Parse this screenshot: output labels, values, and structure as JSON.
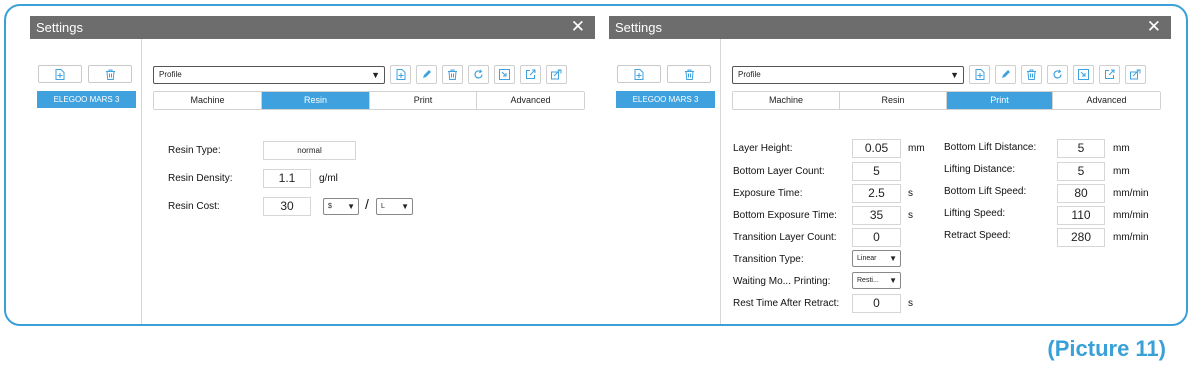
{
  "left_window": {
    "title": "Settings",
    "device": "ELEGOO MARS 3",
    "profile": "Profile",
    "tabs": [
      {
        "label": "Machine",
        "active": false
      },
      {
        "label": "Resin",
        "active": true
      },
      {
        "label": "Print",
        "active": false
      },
      {
        "label": "Advanced",
        "active": false
      }
    ],
    "fields": {
      "resin_type_label": "Resin Type:",
      "resin_type_value": "normal",
      "resin_density_label": "Resin Density:",
      "resin_density_value": "1.1",
      "resin_density_unit": "g/ml",
      "resin_cost_label": "Resin Cost:",
      "resin_cost_value": "30",
      "currency": "$",
      "separator": "/",
      "volume_unit": "L"
    }
  },
  "right_window": {
    "title": "Settings",
    "device": "ELEGOO MARS 3",
    "profile": "Profile",
    "tabs": [
      {
        "label": "Machine",
        "active": false
      },
      {
        "label": "Resin",
        "active": false
      },
      {
        "label": "Print",
        "active": true
      },
      {
        "label": "Advanced",
        "active": false
      }
    ],
    "fields_left": [
      {
        "label": "Layer Height:",
        "value": "0.05",
        "unit": "mm"
      },
      {
        "label": "Bottom Layer Count:",
        "value": "5",
        "unit": ""
      },
      {
        "label": "Exposure Time:",
        "value": "2.5",
        "unit": "s"
      },
      {
        "label": "Bottom Exposure Time:",
        "value": "35",
        "unit": "s"
      },
      {
        "label": "Transition Layer Count:",
        "value": "0",
        "unit": ""
      },
      {
        "label": "Transition Type:",
        "dropdown": "Linear"
      },
      {
        "label": "Waiting Mo... Printing:",
        "dropdown": "Resti..."
      },
      {
        "label": "Rest Time After Retract:",
        "value": "0",
        "unit": "s"
      }
    ],
    "fields_right": [
      {
        "label": "Bottom Lift Distance:",
        "value": "5",
        "unit": "mm"
      },
      {
        "label": "Lifting Distance:",
        "value": "5",
        "unit": "mm"
      },
      {
        "label": "Bottom Lift Speed:",
        "value": "80",
        "unit": "mm/min"
      },
      {
        "label": "Lifting Speed:",
        "value": "110",
        "unit": "mm/min"
      },
      {
        "label": "Retract Speed:",
        "value": "280",
        "unit": "mm/min"
      }
    ]
  },
  "icons": {
    "sidebar": [
      "add-file-icon",
      "trash-icon"
    ],
    "toolbar": [
      "add-file-icon",
      "pencil-icon",
      "trash-icon",
      "refresh-icon",
      "import-icon",
      "export-icon",
      "share-icon"
    ]
  },
  "colors": {
    "accent": "#3fa2df",
    "titlebar": "#6d6d6d",
    "frame": "#3aa0d8"
  },
  "caption": "(Picture 11)"
}
